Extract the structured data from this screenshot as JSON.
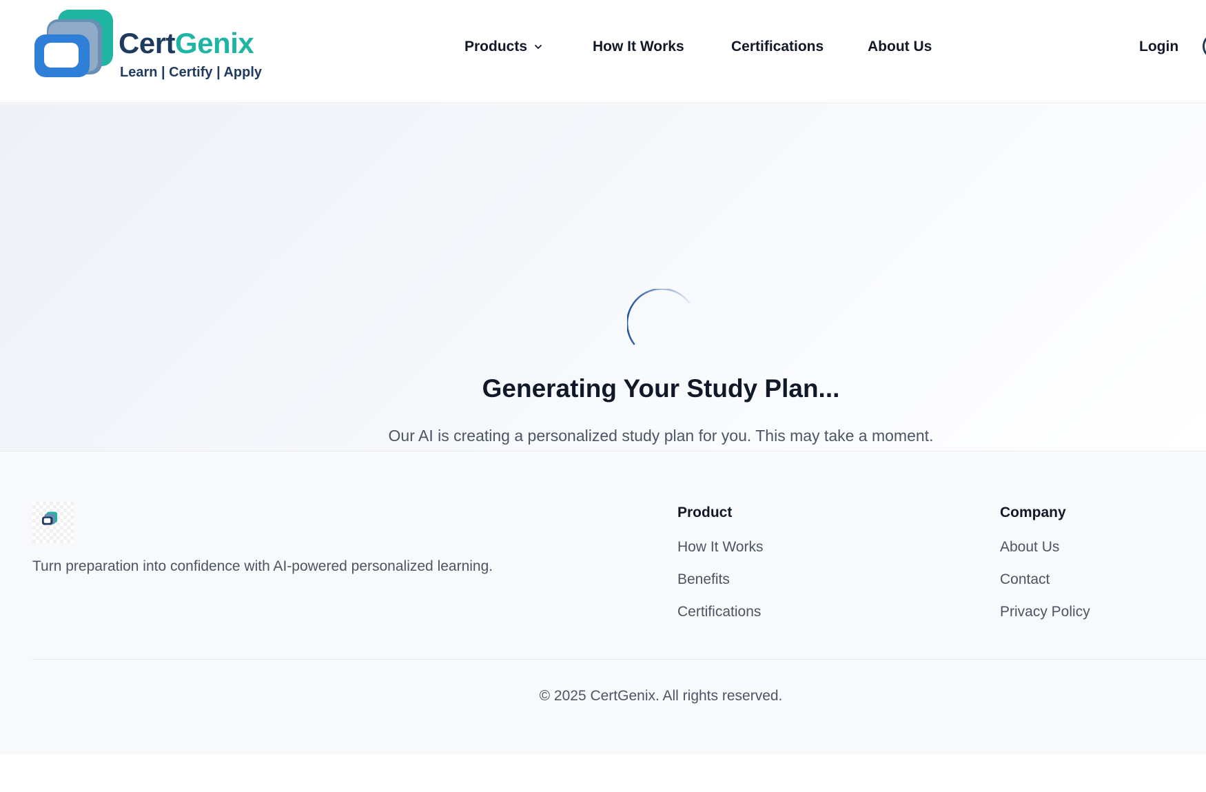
{
  "brand": {
    "name_part1": "Cert",
    "name_part2": "Genix",
    "tagline": "Learn | Certify | Apply",
    "colors": {
      "navy": "#1e3a5f",
      "teal": "#1fb5a2",
      "blue": "#2f7fd8"
    }
  },
  "nav": {
    "items": [
      {
        "label": "Products",
        "has_dropdown": true,
        "icon": "chevron-down-icon"
      },
      {
        "label": "How It Works"
      },
      {
        "label": "Certifications"
      },
      {
        "label": "About Us"
      }
    ],
    "login_label": "Login"
  },
  "loading": {
    "title": "Generating Your Study Plan...",
    "message": "Our AI is creating a personalized study plan for you. This may take a moment.",
    "spinner_color": "#1e4fa3"
  },
  "footer": {
    "tagline": "Turn preparation into confidence with AI-powered personalized learning.",
    "columns": [
      {
        "heading": "Product",
        "links": [
          "How It Works",
          "Benefits",
          "Certifications"
        ]
      },
      {
        "heading": "Company",
        "links": [
          "About Us",
          "Contact",
          "Privacy Policy"
        ]
      }
    ],
    "copyright": "© 2025 CertGenix. All rights reserved."
  }
}
